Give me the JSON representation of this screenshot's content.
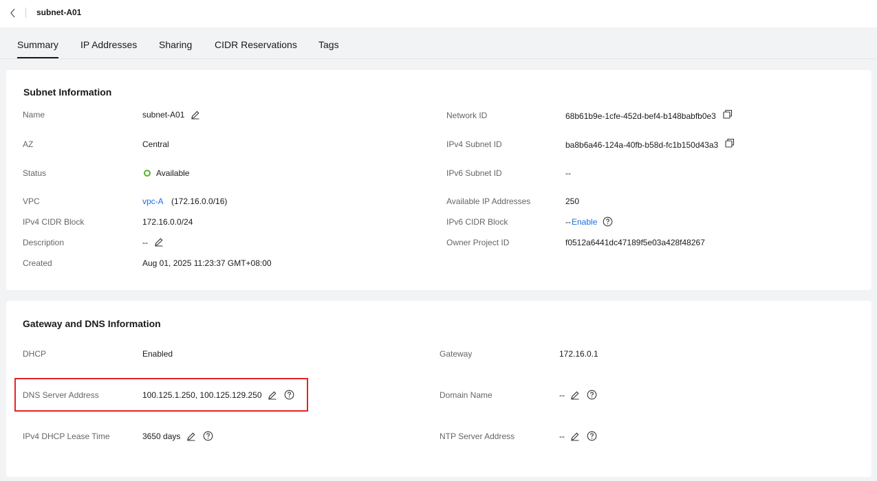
{
  "header": {
    "title": "subnet-A01"
  },
  "tabs": [
    {
      "label": "Summary",
      "active": true
    },
    {
      "label": "IP Addresses"
    },
    {
      "label": "Sharing"
    },
    {
      "label": "CIDR Reservations"
    },
    {
      "label": "Tags"
    }
  ],
  "subnet_info": {
    "title": "Subnet Information",
    "name": {
      "label": "Name",
      "value": "subnet-A01"
    },
    "az": {
      "label": "AZ",
      "value": "Central"
    },
    "status": {
      "label": "Status",
      "value": "Available",
      "color": "#56b02d"
    },
    "vpc": {
      "label": "VPC",
      "link": "vpc-A",
      "cidr": "(172.16.0.0/16)"
    },
    "ipv4_cidr": {
      "label": "IPv4 CIDR Block",
      "value": "172.16.0.0/24"
    },
    "description": {
      "label": "Description",
      "value": "--"
    },
    "created": {
      "label": "Created",
      "value": "Aug 01, 2025 11:23:37 GMT+08:00"
    },
    "network_id": {
      "label": "Network ID",
      "value": "68b61b9e-1cfe-452d-bef4-b148babfb0e3"
    },
    "ipv4_subnet_id": {
      "label": "IPv4 Subnet ID",
      "value": "ba8b6a46-124a-40fb-b58d-fc1b150d43a3"
    },
    "ipv6_subnet_id": {
      "label": "IPv6 Subnet ID",
      "value": "--"
    },
    "available_ips": {
      "label": "Available IP Addresses",
      "value": "250"
    },
    "ipv6_cidr": {
      "label": "IPv6 CIDR Block",
      "prefix": "--",
      "link": "Enable"
    },
    "owner_project": {
      "label": "Owner Project ID",
      "value": "f0512a6441dc47189f5e03a428f48267"
    }
  },
  "gateway_dns": {
    "title": "Gateway and DNS Information",
    "dhcp": {
      "label": "DHCP",
      "value": "Enabled"
    },
    "dns_server": {
      "label": "DNS Server Address",
      "value": "100.125.1.250, 100.125.129.250"
    },
    "lease_time": {
      "label": "IPv4 DHCP Lease Time",
      "value": "3650 days"
    },
    "gateway": {
      "label": "Gateway",
      "value": "172.16.0.1"
    },
    "domain_name": {
      "label": "Domain Name",
      "value": "--"
    },
    "ntp_server": {
      "label": "NTP Server Address",
      "value": "--"
    }
  },
  "colors": {
    "link": "#1a6fe0",
    "highlight": "#e62222",
    "status_ok": "#56b02d"
  },
  "icons": [
    "chevron-left-icon",
    "edit-icon",
    "copy-icon",
    "help-icon"
  ]
}
